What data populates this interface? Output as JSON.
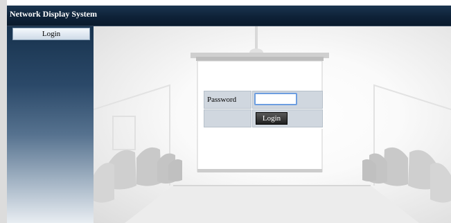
{
  "header": {
    "title": "Network Display System"
  },
  "sidebar": {
    "items": [
      {
        "label": "Login"
      }
    ]
  },
  "form": {
    "password_label": "Password",
    "password_value": "",
    "login_button": "Login"
  }
}
